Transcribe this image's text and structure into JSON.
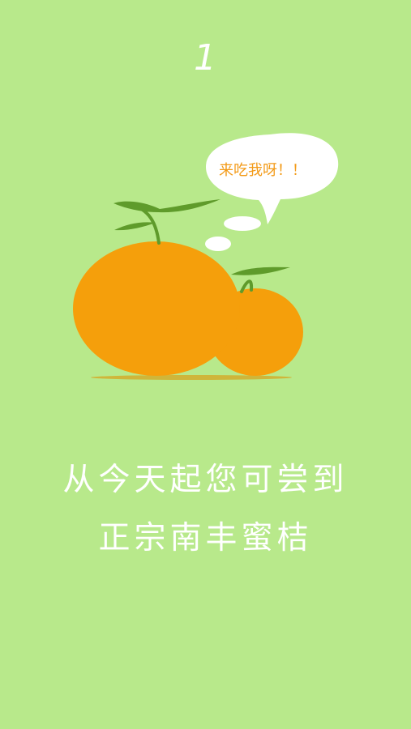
{
  "page": {
    "number": "1",
    "background_color": "#b8e98b"
  },
  "bubble": {
    "text": "来吃我呀！！"
  },
  "illustration": {
    "large_orange_color": "#f59f0b",
    "small_orange_color": "#f59f0b",
    "leaf_color": "#5f9b2b",
    "shadow_color": "#d59a16"
  },
  "message": {
    "line1": "从今天起您可尝到",
    "line2": "正宗南丰蜜桔"
  }
}
